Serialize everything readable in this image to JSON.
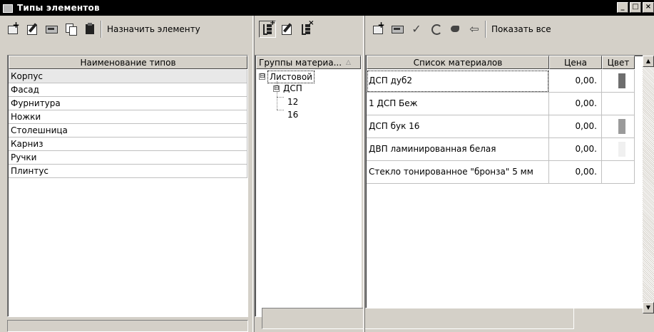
{
  "window": {
    "title": "Типы элементов",
    "buttons": [
      "_",
      "□",
      "×"
    ]
  },
  "left": {
    "toolbar": {
      "assign_label": "Назначить элементу"
    },
    "column_header": "Наименование типов",
    "types": [
      {
        "name": "Корпус",
        "selected": true
      },
      {
        "name": "Фасад",
        "selected": false
      },
      {
        "name": "Фурнитура",
        "selected": false
      },
      {
        "name": "Ножки",
        "selected": false
      },
      {
        "name": "Столешница",
        "selected": false
      },
      {
        "name": "Карниз",
        "selected": false
      },
      {
        "name": "Ручки",
        "selected": false
      },
      {
        "name": "Плинтус",
        "selected": false
      }
    ]
  },
  "middle": {
    "column_header": "Группы материа...",
    "sort_indicator": "△",
    "tree": [
      {
        "label": "Листовой",
        "expander": "⊟",
        "selected": true
      },
      {
        "label": "ДСП",
        "expander": "⊟"
      },
      {
        "label": "12"
      },
      {
        "label": "16"
      }
    ]
  },
  "right": {
    "toolbar": {
      "show_all_label": "Показать все"
    },
    "columns": {
      "name": "Список материалов",
      "price": "Цена",
      "color": "Цвет"
    },
    "materials": [
      {
        "name": "ДСП дуб2",
        "price": "0,00.",
        "color": "#6e6e6e",
        "focused": true
      },
      {
        "name": "1 ДСП Беж",
        "price": "0,00.",
        "color": ""
      },
      {
        "name": "ДСП бук 16",
        "price": "0,00.",
        "color": "#9a9a9a"
      },
      {
        "name": "ДВП ламинированная белая",
        "price": "0,00.",
        "color": "#f0f0f0"
      },
      {
        "name": "Стекло тонированное \"бронза\" 5 мм",
        "price": "0,00.",
        "color": ""
      }
    ]
  },
  "icons": {
    "window": "app-icon",
    "scroll_up": "▲",
    "scroll_down": "▼"
  }
}
